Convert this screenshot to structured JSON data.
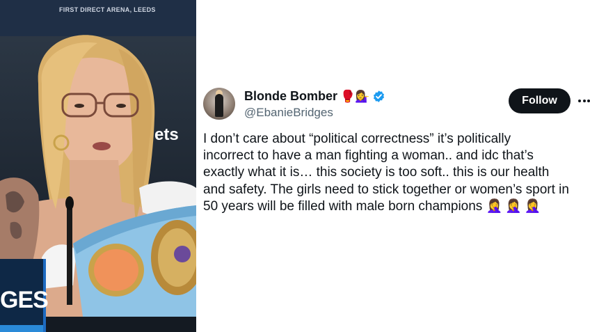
{
  "photo": {
    "banner_text": "FIRST DIRECT ARENA, LEEDS",
    "sponsor_text": "ets",
    "sign_text": "GES"
  },
  "tweet": {
    "display_name": "Blonde Bomber",
    "name_emojis": "🥊💁‍♀️",
    "handle": "@EbanieBridges",
    "follow_label": "Follow",
    "text_lines": [
      "I don’t care about “political correctness” it’s politically",
      "incorrect to have a man fighting a woman.. and idc that’s",
      "exactly what it is… this society is too soft.. this is our health",
      "and safety. The girls need to stick together or women’s sport in",
      "50 years will be filled with male born champions"
    ],
    "trailing_emojis": "🤦‍♀️🤦‍♀️🤦‍♀️"
  },
  "colors": {
    "verified": "#1d9bf0",
    "follow_bg": "#0f1419",
    "handle": "#536471",
    "belt_blue": "#8fc4e6",
    "belt_gold": "#c9a24a"
  },
  "icons": {
    "verified": "verified-badge-icon",
    "more": "more-options-icon"
  }
}
